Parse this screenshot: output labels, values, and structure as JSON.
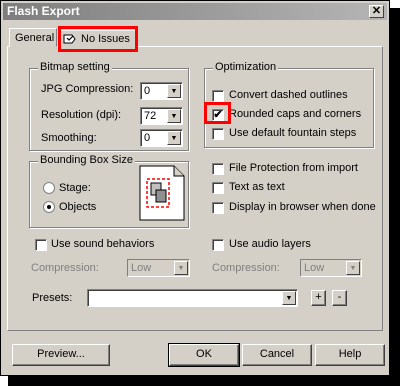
{
  "window": {
    "title": "Flash Export",
    "close_glyph": "✕"
  },
  "tabs": [
    {
      "label": "General"
    },
    {
      "label": "No Issues"
    }
  ],
  "bitmap": {
    "group_label": "Bitmap setting",
    "jpg_label": "JPG Compression:",
    "jpg_value": "0",
    "resolution_label": "Resolution (dpi):",
    "resolution_value": "72",
    "smoothing_label": "Smoothing:",
    "smoothing_value": "0"
  },
  "optimization": {
    "group_label": "Optimization",
    "dashed": {
      "label": "Convert dashed outlines",
      "checked": false
    },
    "rounded": {
      "label": "Rounded caps and corners",
      "checked": true
    },
    "fountain": {
      "label": "Use default fountain steps",
      "checked": false
    }
  },
  "bbox": {
    "group_label": "Bounding Box Size",
    "stage_label": "Stage:",
    "objects_label": "Objects",
    "selected": "objects"
  },
  "options": {
    "protection": {
      "label": "File Protection from import",
      "checked": false
    },
    "text": {
      "label": "Text as text",
      "checked": false
    },
    "browser": {
      "label": "Display in browser when done",
      "checked": false
    }
  },
  "sound": {
    "label": "Use sound behaviors",
    "compression_label": "Compression:",
    "compression_value": "Low"
  },
  "audio": {
    "label": "Use audio layers",
    "compression_label": "Compression:",
    "compression_value": "Low"
  },
  "presets": {
    "label": "Presets:",
    "value": "",
    "add": "+",
    "remove": "-"
  },
  "buttons": {
    "preview": "Preview...",
    "ok": "OK",
    "cancel": "Cancel",
    "help": "Help"
  },
  "colors": {
    "highlight": "#ff0000",
    "face": "#d4d0c8"
  }
}
